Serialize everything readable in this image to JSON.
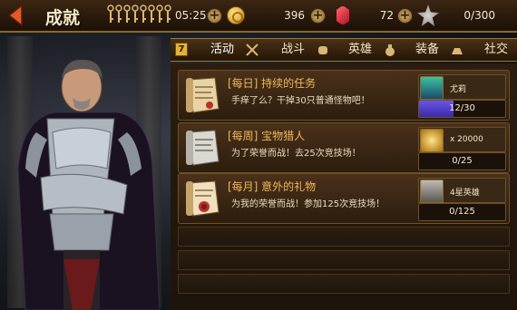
{
  "header": {
    "title": "成就",
    "timer": "05:25",
    "gold": "396",
    "gems": "72",
    "honor": "0/300"
  },
  "tabs": {
    "badge": "7",
    "items": [
      {
        "label": "活动",
        "icon": "crossed-swords-icon"
      },
      {
        "label": "战斗",
        "icon": "fist-icon"
      },
      {
        "label": "英雄",
        "icon": "money-bag-icon"
      },
      {
        "label": "装备",
        "icon": "ingot-icon"
      },
      {
        "label": "社交",
        "icon": "social-icon"
      }
    ]
  },
  "achievements": [
    {
      "name": "[每日] 持续的任务",
      "desc": "手痒了么？干掉30只普通怪物吧！",
      "reward_label": "尤莉",
      "reward_icon": "hero-portrait-icon",
      "progress_text": "12/30",
      "progress": 0.4
    },
    {
      "name": "[每周] 宝物猎人",
      "desc": "为了荣誉而战！去25次竞技场！",
      "reward_label": "x 20000",
      "reward_icon": "gold-pile-icon",
      "progress_text": "0/25",
      "progress": 0
    },
    {
      "name": "[每月] 意外的礼物",
      "desc": "为我的荣誉而战！参加125次竞技场！",
      "reward_label": "4星英雄",
      "reward_icon": "star-hero-card-icon",
      "progress_text": "0/125",
      "progress": 0
    }
  ],
  "colors": {
    "accent": "#f1b85a",
    "progress": "#5a48d8"
  }
}
